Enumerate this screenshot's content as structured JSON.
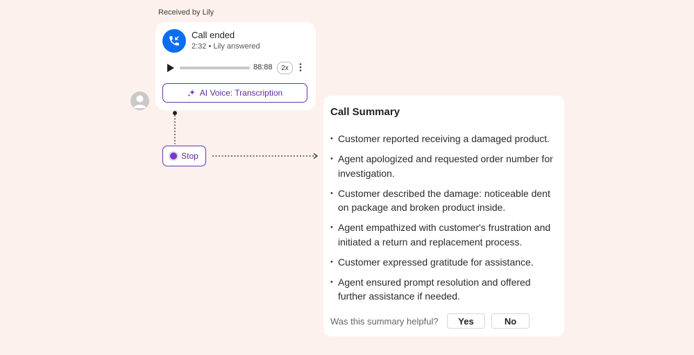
{
  "received_label": "Received by Lily",
  "call": {
    "title": "Call ended",
    "subtitle": "2:32 • Lily answered",
    "duration": "88:88",
    "speed": "2x",
    "progress": 0.0,
    "ai_button_label": "AI Voice: Transcription",
    "icons": {
      "status": "phone-incoming-icon",
      "play": "play-icon",
      "more": "more-vertical-icon",
      "sparkle": "sparkle-icon"
    }
  },
  "stop_button_label": "Stop",
  "summary": {
    "title": "Call Summary",
    "items": [
      "Customer reported receiving a damaged product.",
      "Agent apologized and requested order number for investigation.",
      "Customer described the damage: noticeable dent on package and broken product inside.",
      "Agent empathized with customer's frustration and initiated a return and replacement process.",
      "Customer expressed gratitude for assistance.",
      "Agent ensured prompt resolution and offered further assistance if needed."
    ],
    "feedback_question": "Was this summary helpful?",
    "yes_label": "Yes",
    "no_label": "No"
  },
  "colors": {
    "background": "#fdf1ed",
    "accent_purple": "#6f2fb0",
    "phone_blue": "#0b6df2"
  }
}
